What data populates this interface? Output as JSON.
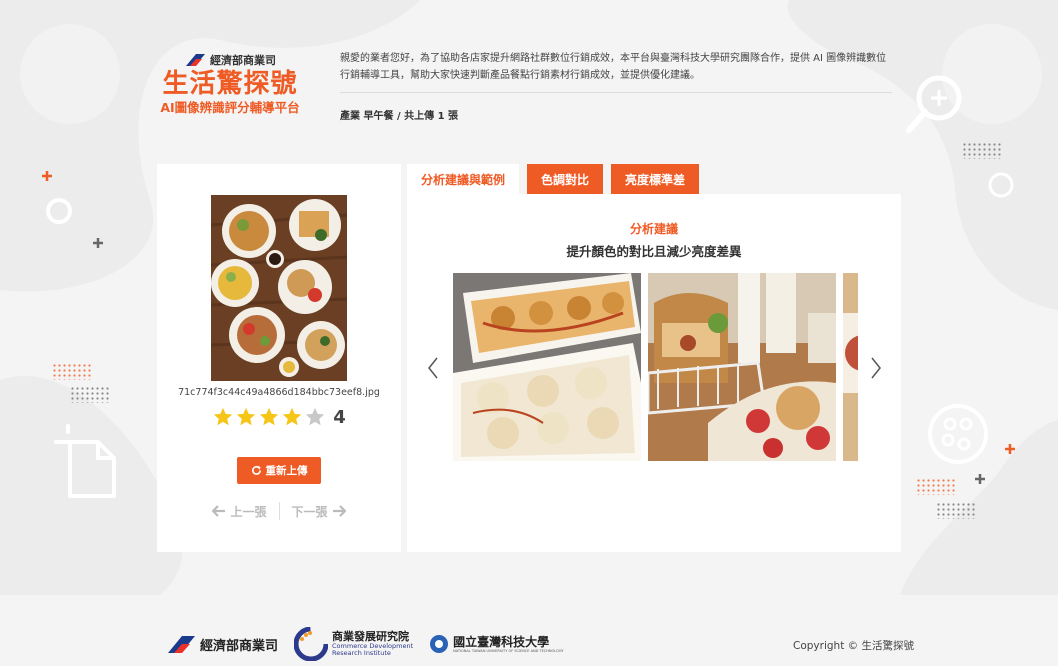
{
  "header": {
    "gov_name": "經濟部商業司",
    "brand_title": "生活驚探號",
    "brand_subtitle": "AI圖像辨識評分輔導平台",
    "intro": "親愛的業者您好，為了協助各店家提升網路社群數位行銷成效，本平台與臺灣科技大學研究團隊合作，提供 AI 圖像辨識數位行銷輔導工具，幫助大家快速判斷產品餐點行銷素材行銷成效，並提供優化建議。",
    "meta": "產業 早午餐 / 共上傳 1 張"
  },
  "upload": {
    "filename": "71c774f3c44c49a4866d184bbc73eef8.jpg",
    "rating": 4,
    "rating_max": 5,
    "rating_text": "4",
    "reupload_label": "重新上傳",
    "prev_label": "上一張",
    "next_label": "下一張"
  },
  "tabs": [
    {
      "label": "分析建議與範例",
      "active": true
    },
    {
      "label": "色調對比",
      "active": false
    },
    {
      "label": "亮度標準差",
      "active": false
    }
  ],
  "analysis": {
    "label": "分析建議",
    "text": "提升顏色的對比且減少亮度差異"
  },
  "footer": {
    "logo1": "經濟部商業司",
    "logo2_line1": "商業發展研究院",
    "logo2_line2": "Commerce Development",
    "logo2_line3": "Research Institute",
    "logo3_line1": "國立臺灣科技大學",
    "logo3_line2": "NATIONAL TAIWAN UNIVERSITY OF SCIENCE AND TECHNOLOGY",
    "copyright": "Copyright © 生活驚探號"
  },
  "colors": {
    "accent": "#ef5b25",
    "star_filled": "#f5c518",
    "star_empty": "#c8c8c8"
  }
}
